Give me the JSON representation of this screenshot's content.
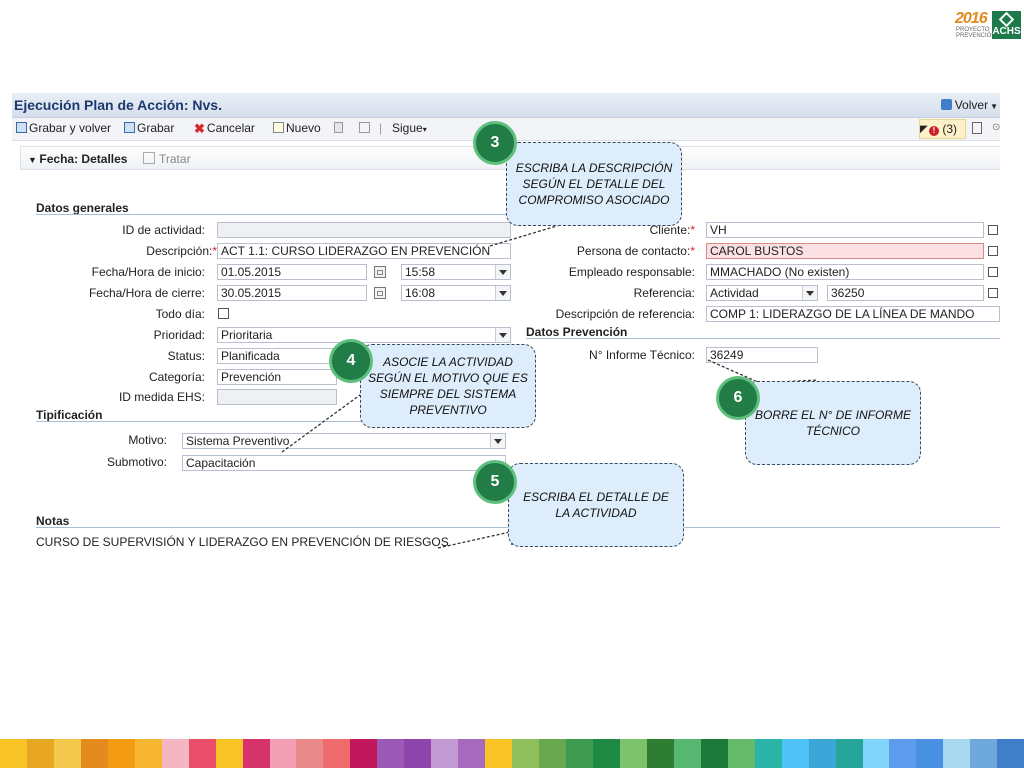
{
  "logo": {
    "year": "2016",
    "subtitle": "PROYECTO PREVENCIÓN",
    "brand": "ACHS"
  },
  "app": {
    "title": "Ejecución Plan de Acción: Nvs.",
    "back_label": "Volver",
    "toolbar": {
      "save_back": "Grabar y volver",
      "save": "Grabar",
      "cancel": "Cancelar",
      "new": "Nuevo",
      "next": "Sigue",
      "alerts": "(3)"
    },
    "tabs": {
      "active": "Fecha: Detalles",
      "other": "Tratar"
    },
    "sections": {
      "general": "Datos generales",
      "tipificacion": "Tipificación",
      "prevencion": "Datos Prevención",
      "notas": "Notas"
    },
    "left_form": {
      "id_label": "ID de actividad:",
      "id_value": "",
      "desc_label": "Descripción:",
      "desc_value": "ACT 1.1: CURSO LIDERAZGO EN PREVENCIÓN",
      "start_label": "Fecha/Hora de inicio:",
      "start_date": "01.05.2015",
      "start_time": "15:58",
      "end_label": "Fecha/Hora de cierre:",
      "end_date": "30.05.2015",
      "end_time": "16:08",
      "allday_label": "Todo día:",
      "priority_label": "Prioridad:",
      "priority_value": "Prioritaria",
      "status_label": "Status:",
      "status_value": "Planificada",
      "category_label": "Categoría:",
      "category_value": "Prevención",
      "ehs_label": "ID medida EHS:",
      "ehs_value": ""
    },
    "tip_form": {
      "motivo_label": "Motivo:",
      "motivo_value": "Sistema Preventivo",
      "submotivo_label": "Submotivo:",
      "submotivo_value": "Capacitación"
    },
    "right_form": {
      "client_label": "Cliente:",
      "client_value": "VH",
      "contact_label": "Persona de contacto:",
      "contact_value": "CAROL BUSTOS",
      "employee_label": "Empleado responsable:",
      "employee_value": "MMACHADO (No existen)",
      "ref_label": "Referencia:",
      "ref_type": "Actividad",
      "ref_value": "36250",
      "refdesc_label": "Descripción de referencia:",
      "refdesc_value": "COMP 1: LIDERAZGO DE LA LÍNEA DE MANDO",
      "informe_label": "N° Informe Técnico:",
      "informe_value": "36249"
    },
    "notes_value": "CURSO DE SUPERVISIÓN Y LIDERAZGO EN PREVENCIÓN DE RIESGOS"
  },
  "callouts": [
    {
      "number": "3",
      "text": "ESCRIBA LA DESCRIPCIÓN SEGÚN EL DETALLE DEL COMPROMISO ASOCIADO"
    },
    {
      "number": "4",
      "text": "ASOCIE LA ACTIVIDAD SEGÚN EL MOTIVO QUE ES SIEMPRE DEL SISTEMA PREVENTIVO"
    },
    {
      "number": "5",
      "text": "ESCRIBA EL DETALLE DE LA ACTIVIDAD"
    },
    {
      "number": "6",
      "text": "BORRE EL N° DE INFORME TÉCNICO"
    }
  ],
  "colors": {
    "section_text": "#222222",
    "callout_fill": "#deedfb",
    "badge_fill": "#217c46",
    "required": "#d7262c",
    "band": [
      "#f7c325",
      "#e8a722",
      "#f2c94c",
      "#e58a1f",
      "#f39c12",
      "#f7b733",
      "#f4b6c2",
      "#e94e6b",
      "#f7c325",
      "#d6336c",
      "#f29fb4",
      "#e98a8a",
      "#f06b6b",
      "#c2185b",
      "#9b59b6",
      "#8e44ad",
      "#c39bd3",
      "#a569bd",
      "#f7c325",
      "#8fbf5a",
      "#6aa84f",
      "#3e9b4f",
      "#1f8a44",
      "#7cc36b",
      "#2e7d32",
      "#56b870",
      "#1b7a3a",
      "#66bb6a",
      "#2bb5a8",
      "#4fc3f7",
      "#3ba7d9",
      "#26a69a",
      "#81d4fa",
      "#5d9cec",
      "#4a90e2",
      "#a8d8f0",
      "#6fa8dc",
      "#3f7fc9"
    ]
  }
}
